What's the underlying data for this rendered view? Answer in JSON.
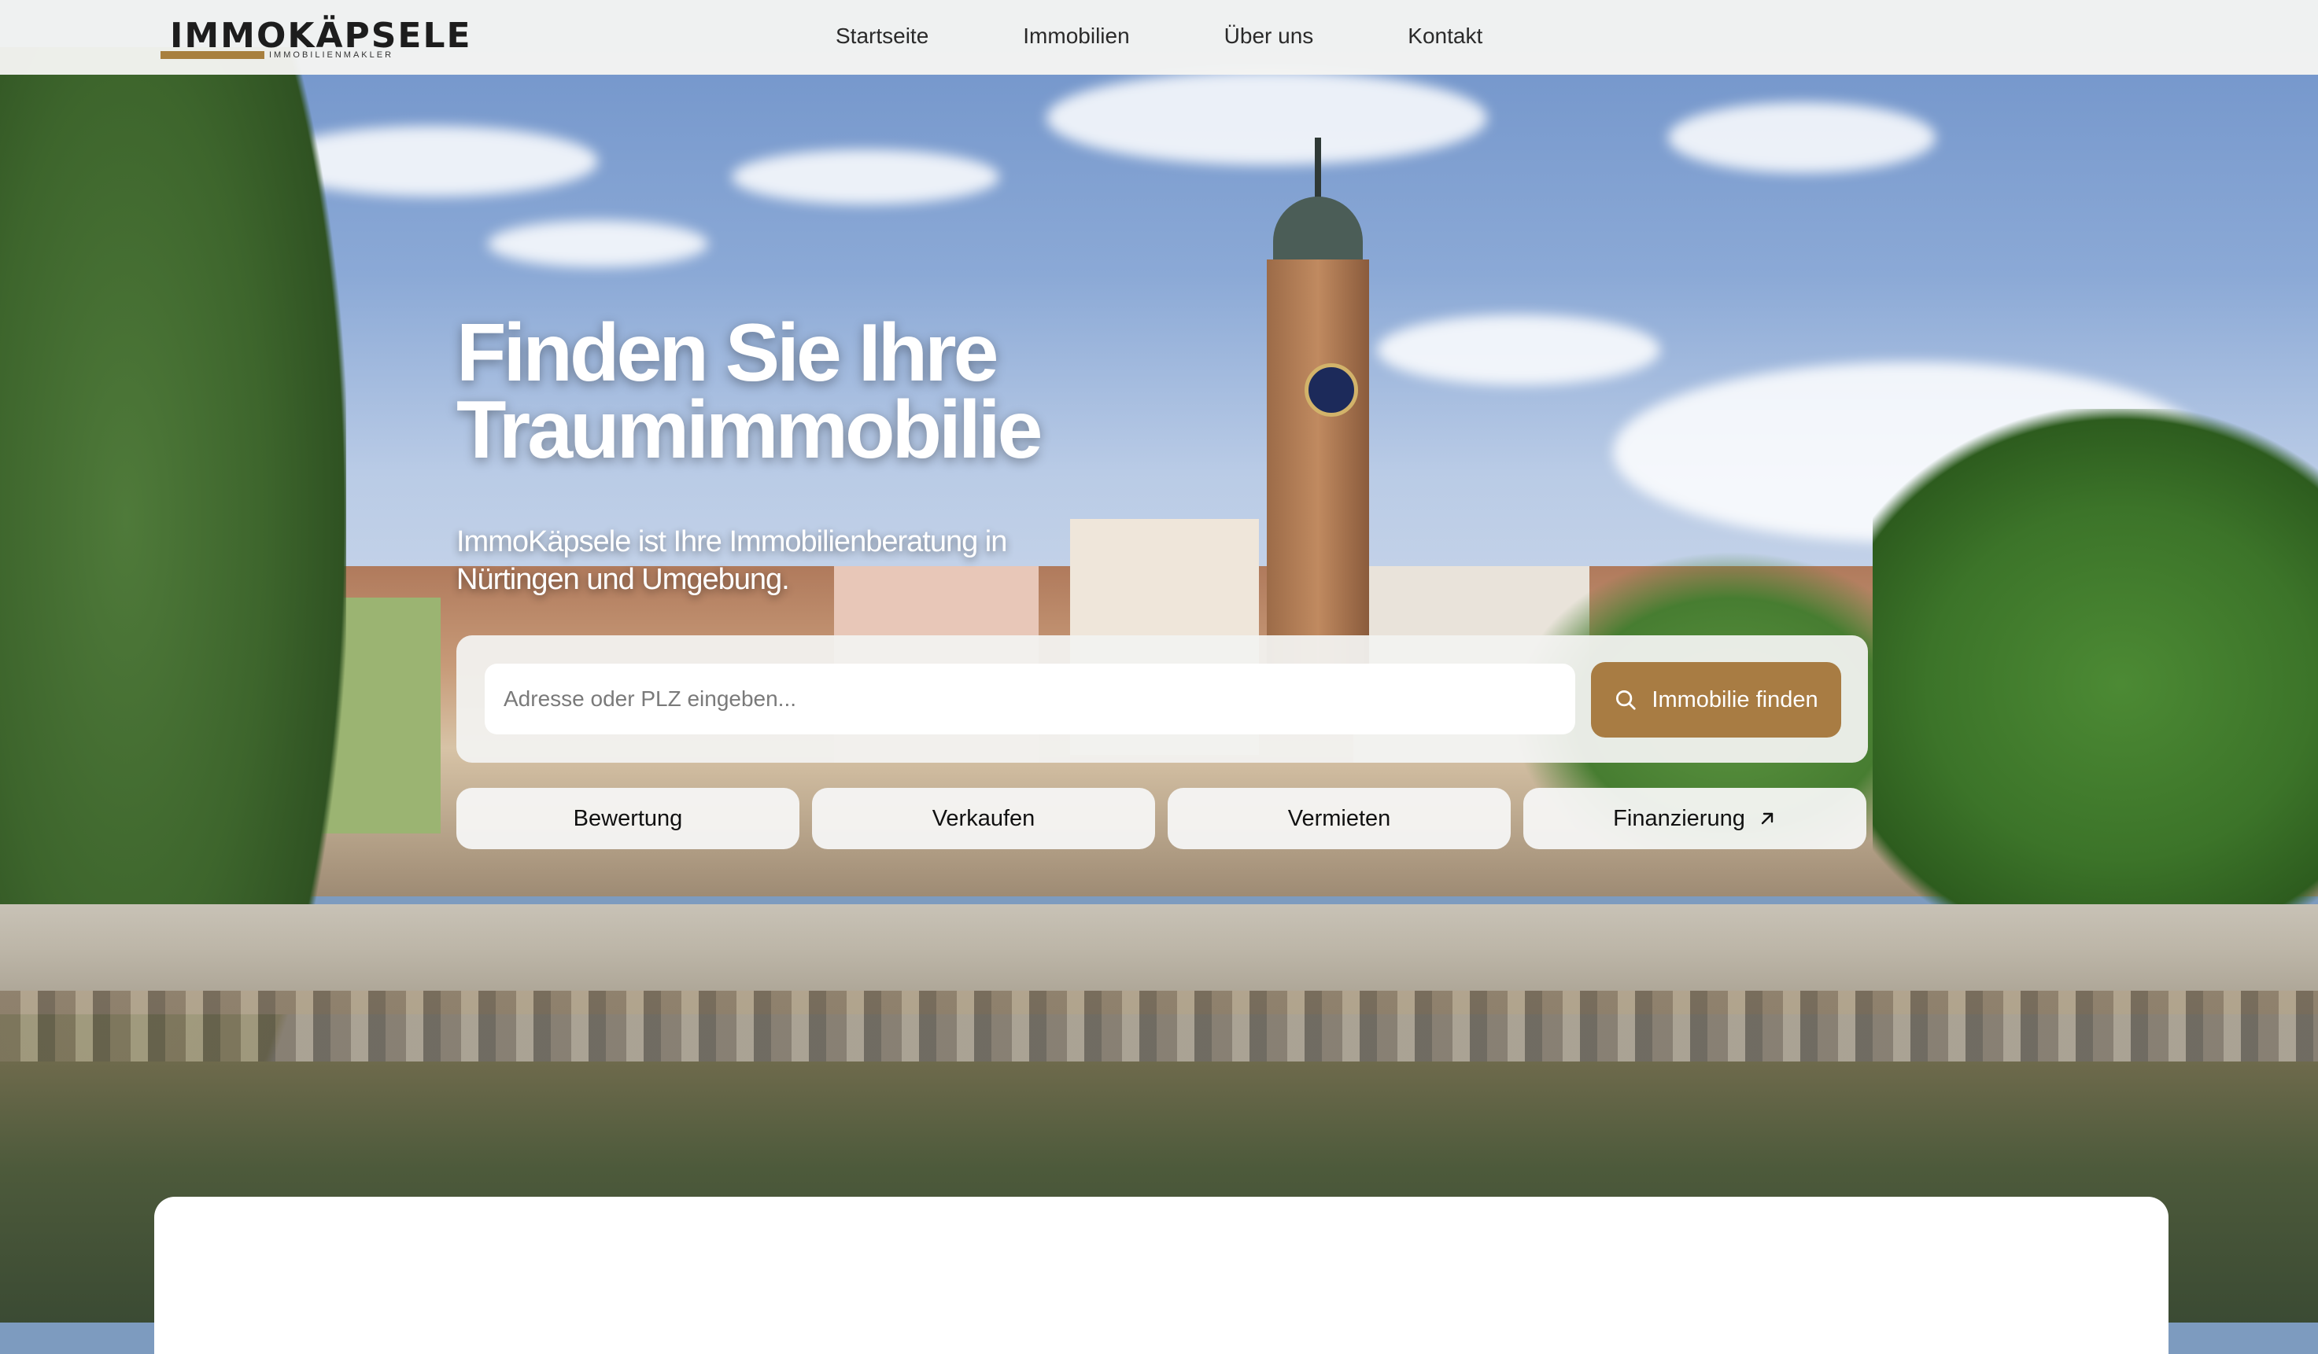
{
  "brand": {
    "name": "IMMOKÄPSELE",
    "tagline": "IMMOBILIENMAKLER",
    "accent_color": "#a87c43"
  },
  "nav": {
    "items": [
      {
        "label": "Startseite"
      },
      {
        "label": "Immobilien"
      },
      {
        "label": "Über uns"
      },
      {
        "label": "Kontakt"
      }
    ]
  },
  "hero": {
    "headline_line1": "Finden Sie Ihre",
    "headline_line2": "Traumimmobilie",
    "subline": "ImmoKäpsele ist Ihre Immobilienberatung in Nürtingen und Umgebung."
  },
  "search": {
    "placeholder": "Adresse oder PLZ eingeben...",
    "value": "",
    "button_label": "Immobilie finden",
    "button_icon": "search-icon"
  },
  "quick_links": [
    {
      "label": "Bewertung"
    },
    {
      "label": "Verkaufen"
    },
    {
      "label": "Vermieten"
    },
    {
      "label": "Finanzierung",
      "icon": "arrow-up-right-icon"
    }
  ]
}
